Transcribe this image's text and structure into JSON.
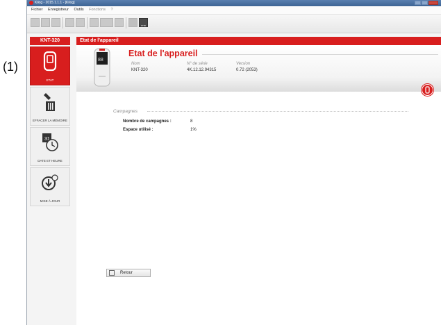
{
  "annotation": "(1)",
  "window": {
    "title": "Kilog - 2015.1.1.1 - [Kilog]"
  },
  "menu": {
    "items": [
      "Fichier",
      "Enregistreur",
      "Outils"
    ],
    "disabled_items": [
      "Fonctions",
      "?"
    ]
  },
  "toolbar": {
    "device_button_text": "KT50"
  },
  "sidebar": {
    "title": "KNT-320",
    "items": [
      {
        "label": "ETAT",
        "icon": "device-icon",
        "active": true
      },
      {
        "label": "EFFACER LA MÉMOIRE",
        "icon": "erase-icon",
        "active": false
      },
      {
        "label": "DATE ET HEURE",
        "icon": "calendar-clock-icon",
        "active": false
      },
      {
        "label": "MISE À JOUR",
        "icon": "update-icon",
        "active": false
      }
    ]
  },
  "main": {
    "header": "Etat de l'appareil",
    "title": "Etat de l'appareil",
    "columns": {
      "nom_label": "Nom",
      "nom_value": "KNT-320",
      "serie_label": "N° de série",
      "serie_value": "4K.12.12.94315",
      "version_label": "Version",
      "version_value": "0.72 (2053)"
    },
    "campagnes": {
      "title": "Campagnes",
      "rows": [
        {
          "label": "Nombre de campagnes :",
          "value": "8"
        },
        {
          "label": "Espace utilisé :",
          "value": "1%"
        }
      ]
    },
    "retour_label": "Retour"
  },
  "colors": {
    "accent": "#d81e1e",
    "titlebar": "#3d6494"
  }
}
